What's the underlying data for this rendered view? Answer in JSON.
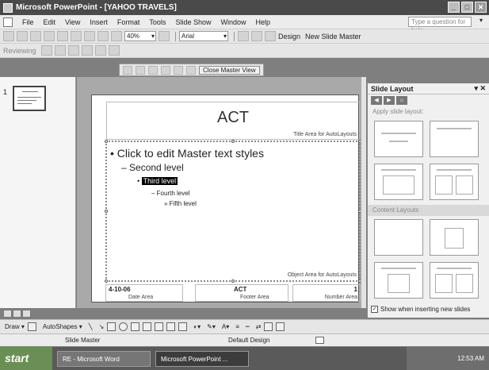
{
  "window": {
    "title": "Microsoft PowerPoint - [YAHOO TRAVELS]"
  },
  "menu": {
    "items": [
      "File",
      "Edit",
      "View",
      "Insert",
      "Format",
      "Tools",
      "Slide Show",
      "Window",
      "Help"
    ],
    "help_placeholder": "Type a question for help"
  },
  "toolbar": {
    "zoom": "40%",
    "font": "Arial",
    "design_label": "Design",
    "new_slide_master_label": "New Slide Master",
    "reviewing_label": "Reviewing",
    "close_master_view_label": "Close Master View"
  },
  "thumbnails": {
    "slide_number": "1"
  },
  "slide": {
    "title": "ACT",
    "title_area_label": "Title Area for AutoLayouts",
    "bullets": {
      "level1": "Click to edit Master text styles",
      "level2": "Second level",
      "level3": "Third level",
      "level4": "Fourth level",
      "level5": "Fifth level"
    },
    "object_area_label": "Object Area for AutoLayouts",
    "footer": {
      "date_value": "4-10-06",
      "date_label": "Date Area",
      "footer_value": "ACT",
      "footer_label": "Footer Area",
      "number_value": "1",
      "number_label": "Number Area"
    }
  },
  "taskpane": {
    "title": "Slide Layout",
    "apply_label": "Apply slide layout:",
    "content_layouts_label": "Content Layouts",
    "show_when_inserting": "Show when inserting new slides"
  },
  "drawbar": {
    "draw_label": "Draw",
    "autoshapes_label": "AutoShapes"
  },
  "statusbar": {
    "mode": "Slide Master",
    "design": "Default Design"
  },
  "taskbar": {
    "start_label": "start",
    "tasks": [
      "RE - Microsoft Word",
      "Microsoft PowerPoint ..."
    ],
    "clock": "12:53 AM"
  }
}
